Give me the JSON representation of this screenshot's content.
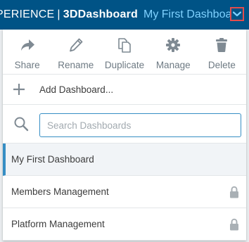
{
  "topbar": {
    "brand_prefix": "PERIENCE",
    "separator": "|",
    "app_name": "3DDashboard",
    "dashboard_title": "My First Dashboard"
  },
  "toolbar": {
    "share": "Share",
    "rename": "Rename",
    "duplicate": "Duplicate",
    "manage": "Manage",
    "delete": "Delete"
  },
  "add_dashboard": {
    "label": "Add Dashboard..."
  },
  "search": {
    "placeholder": "Search Dashboards",
    "value": ""
  },
  "dashboards": [
    {
      "label": "My First Dashboard",
      "active": true,
      "locked": false
    },
    {
      "label": "Members Management",
      "active": false,
      "locked": true
    },
    {
      "label": "Platform Management",
      "active": false,
      "locked": true
    }
  ],
  "colors": {
    "topbar_bg": "#005386",
    "title_accent": "#7fd1ff",
    "highlight_border": "#e34d4d",
    "active_accent": "#368ec4",
    "icon_gray": "#7f8a93"
  },
  "icons": {
    "share": "share-arrow-icon",
    "rename": "pencil-icon",
    "duplicate": "copy-icon",
    "manage": "gear-icon",
    "delete": "trash-icon",
    "add": "plus-icon",
    "search": "search-icon",
    "lock": "lock-icon",
    "menu": "chevron-down-icon"
  }
}
